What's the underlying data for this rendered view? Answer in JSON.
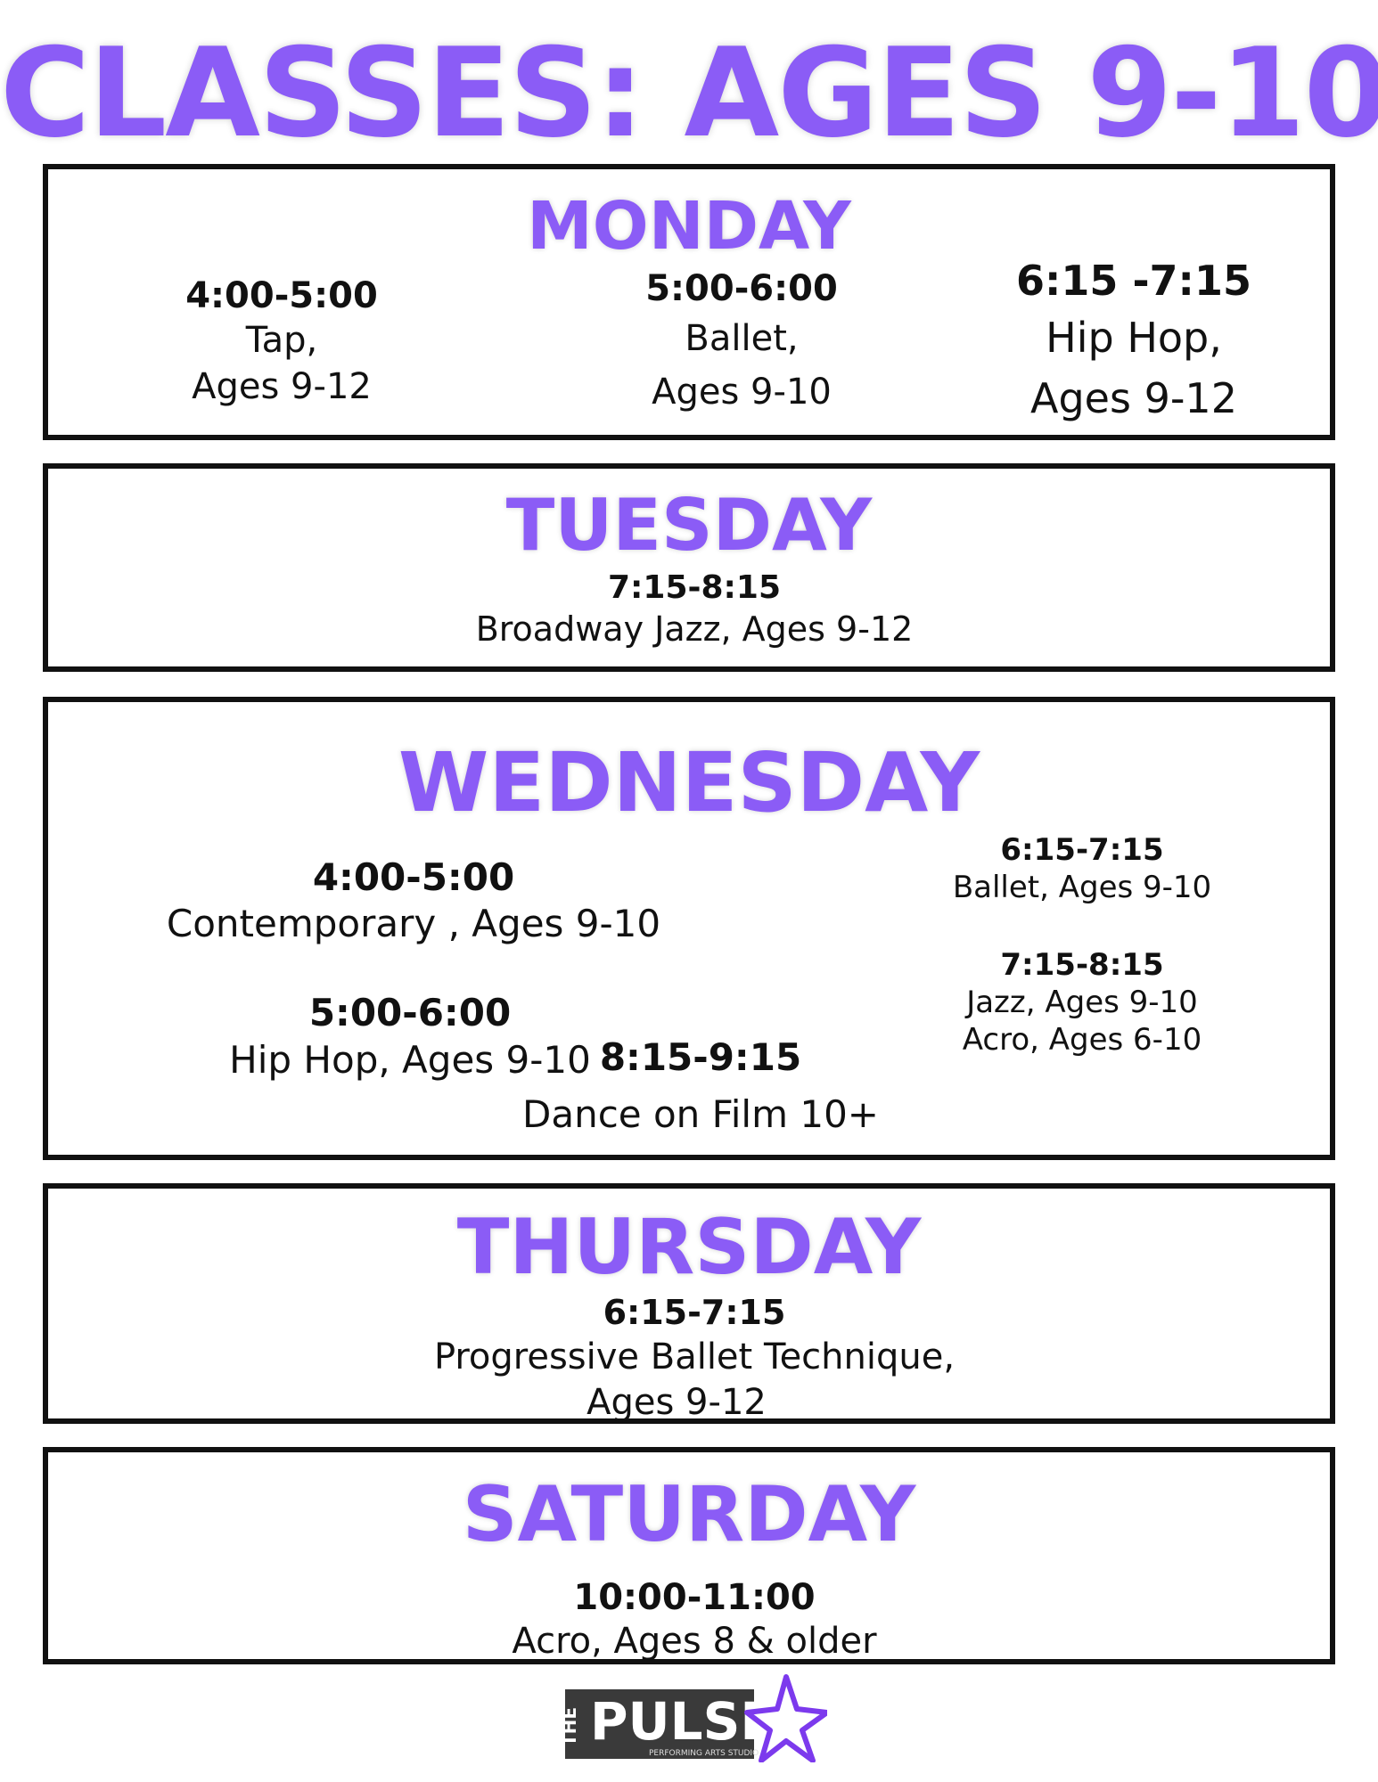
{
  "title": "CLASSES: AGES 9-10",
  "colors": {
    "accent": "#8b5cf6",
    "text": "#111111",
    "border": "#111111"
  },
  "monday": {
    "day": "MONDAY",
    "classes": [
      {
        "time": "4:00-5:00",
        "line1": "Tap,",
        "line2": "Ages 9-12"
      },
      {
        "time": "5:00-6:00",
        "line1": "Ballet,",
        "line2": "Ages 9-10"
      },
      {
        "time": "6:15 -7:15",
        "line1": "Hip Hop,",
        "line2": "Ages 9-12"
      }
    ]
  },
  "tuesday": {
    "day": "TUESDAY",
    "classes": [
      {
        "time": "7:15-8:15",
        "line1": "Broadway Jazz, Ages 9-12"
      }
    ]
  },
  "wednesday": {
    "day": "WEDNESDAY",
    "classes": [
      {
        "time": "4:00-5:00",
        "line1": "Contemporary , Ages 9-10"
      },
      {
        "time": "5:00-6:00",
        "line1": "Hip Hop, Ages 9-10"
      },
      {
        "time": "8:15-9:15",
        "line1": "Dance on Film 10+"
      },
      {
        "time": "6:15-7:15",
        "line1": "Ballet, Ages 9-10"
      },
      {
        "time": "7:15-8:15",
        "line1": "Jazz, Ages 9-10",
        "line2": "Acro, Ages 6-10"
      }
    ]
  },
  "thursday": {
    "day": "THURSDAY",
    "classes": [
      {
        "time": "6:15-7:15",
        "line1": "Progressive Ballet Technique,",
        "line2": "Ages 9-12"
      }
    ]
  },
  "saturday": {
    "day": "SATURDAY",
    "classes": [
      {
        "time": "10:00-11:00",
        "line1": "Acro, Ages 8 & older"
      }
    ]
  },
  "logo": {
    "word_the": "THE",
    "word_pulse": "PULSE",
    "tagline": "PERFORMING ARTS STUDIO",
    "icon": "star-icon"
  }
}
